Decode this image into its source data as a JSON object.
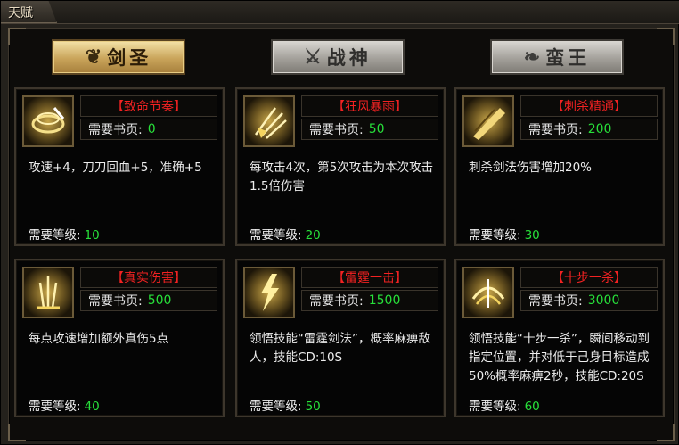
{
  "window": {
    "title": "天赋"
  },
  "tabs": [
    {
      "label": "剑圣",
      "emblem": "❦",
      "active": true
    },
    {
      "label": "战神",
      "emblem": "⚔",
      "active": false
    },
    {
      "label": "蛮王",
      "emblem": "❧",
      "active": false
    }
  ],
  "labels": {
    "pages_prefix": "需要书页:",
    "level_prefix": "需要等级:"
  },
  "cards": [
    {
      "name": "【致命节奏】",
      "pages": "0",
      "desc": "攻速+4，刀刀回血+5，准确+5",
      "level": "10",
      "icon": "rhythm-icon"
    },
    {
      "name": "【狂风暴雨】",
      "pages": "50",
      "desc": "每攻击4次，第5次攻击为本次攻击1.5倍伤害",
      "level": "20",
      "icon": "storm-icon"
    },
    {
      "name": "【刺杀精通】",
      "pages": "200",
      "desc": "刺杀剑法伤害增加20%",
      "level": "30",
      "icon": "thrust-icon"
    },
    {
      "name": "【真实伤害】",
      "pages": "500",
      "desc": "每点攻速增加额外真伤5点",
      "level": "40",
      "icon": "true-damage-icon"
    },
    {
      "name": "【雷霆一击】",
      "pages": "1500",
      "desc": "领悟技能“雷霆剑法”，概率麻痹敌人，技能CD:10S",
      "level": "50",
      "icon": "thunder-icon"
    },
    {
      "name": "【十步一杀】",
      "pages": "3000",
      "desc": "领悟技能“十步一杀”，瞬间移动到指定位置，并对低于己身目标造成50%概率麻痹2秒，技能CD:20S",
      "level": "60",
      "icon": "ten-steps-icon"
    }
  ]
}
